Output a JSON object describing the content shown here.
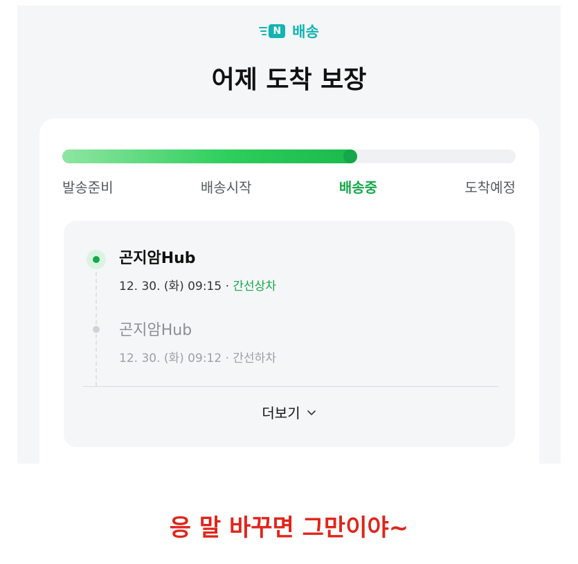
{
  "header": {
    "brand_badge": "N",
    "brand_label": "배송",
    "title": "어제 도착 보장"
  },
  "progress": {
    "value": 0.65,
    "steps": [
      {
        "label": "발송준비",
        "active": false
      },
      {
        "label": "배송시작",
        "active": false
      },
      {
        "label": "배송중",
        "active": true
      },
      {
        "label": "도착예정",
        "active": false
      }
    ]
  },
  "events": [
    {
      "location": "곤지암Hub",
      "datetime": "12. 30. (화) 09:15",
      "separator": "·",
      "status": "간선상차"
    },
    {
      "location": "곤지암Hub",
      "datetime": "12. 30. (화) 09:12",
      "separator": "·",
      "status": "간선하차"
    }
  ],
  "more_label": "더보기",
  "caption": "응 말 바꾸면 그만이야~",
  "colors": {
    "accent": "#14a84a",
    "brand": "#12b3b3",
    "caption": "#e0241b"
  }
}
